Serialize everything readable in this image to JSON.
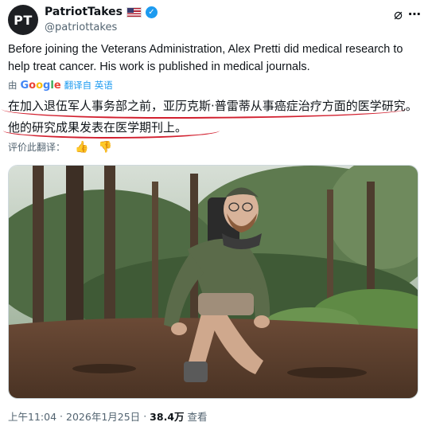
{
  "author": {
    "avatar_text": "PT",
    "display_name": "PatriotTakes",
    "handle": "@patriottakes",
    "verified_mark": "✓"
  },
  "header_icons": {
    "grok": "⌀",
    "more": "⋯"
  },
  "tweet": {
    "text": "Before joining the Veterans Administration, Alex Pretti did medical research to help treat cancer. His work is published in medical journals."
  },
  "translation_bar": {
    "prefix": "由",
    "translated_by": "翻译自 英语"
  },
  "translation": {
    "text": "在加入退伍军人事务部之前，亚历克斯·普雷蒂从事癌症治疗方面的医学研究。他的研究成果发表在医学期刊上。"
  },
  "rate": {
    "label": "评价此翻译：",
    "thumbs_up": "👍",
    "thumbs_down": "👎"
  },
  "footer": {
    "time": "上午11:04",
    "sep1": "·",
    "date": "2026年1月25日",
    "sep2": "·",
    "views": "38.4万",
    "views_label": "查看"
  },
  "colors": {
    "verified": "#1d9bf0",
    "underline": "#d2202f",
    "muted": "#536471"
  }
}
